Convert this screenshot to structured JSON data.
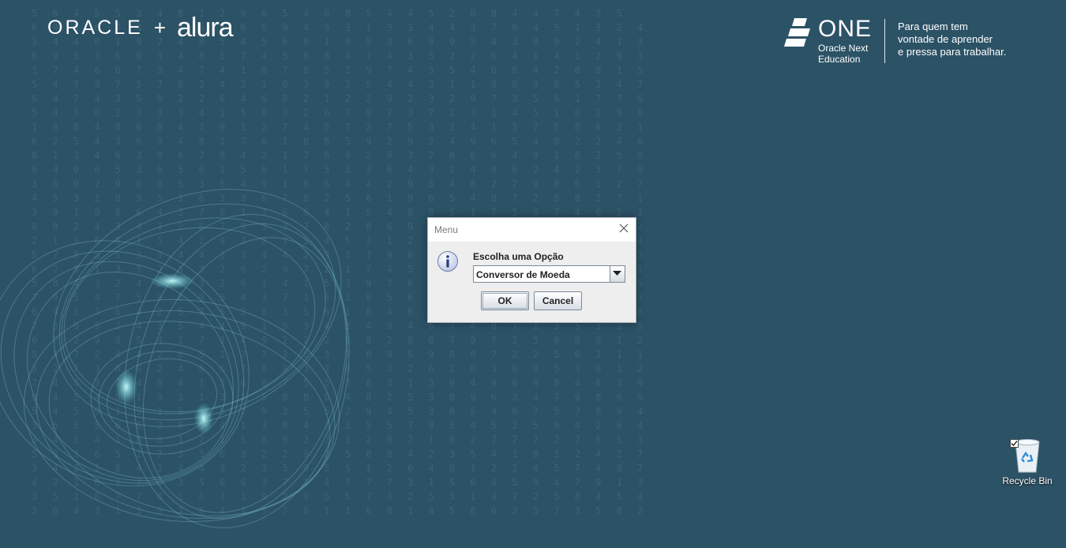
{
  "desktop": {
    "brand_left": {
      "oracle": "ORACLE",
      "plus": "+",
      "alura": "alura"
    },
    "brand_right": {
      "one": "ONE",
      "sub_line1": "Oracle Next",
      "sub_line2": "Education",
      "tagline_line1": "Para quem tem",
      "tagline_line2": "vontade de aprender",
      "tagline_line3": "e pressa para trabalhar."
    },
    "icons": [
      {
        "name": "Recycle Bin",
        "icon": "recycle-bin-icon",
        "checked": true
      }
    ],
    "background_color": "#2c5266",
    "accent_color": "#5fd3d8"
  },
  "dialog": {
    "title": "Menu",
    "icon": "info-icon",
    "prompt": "Escolha uma Opção",
    "select": {
      "value": "Conversor de Moeda"
    },
    "buttons": {
      "ok": "OK",
      "cancel": "Cancel"
    }
  }
}
